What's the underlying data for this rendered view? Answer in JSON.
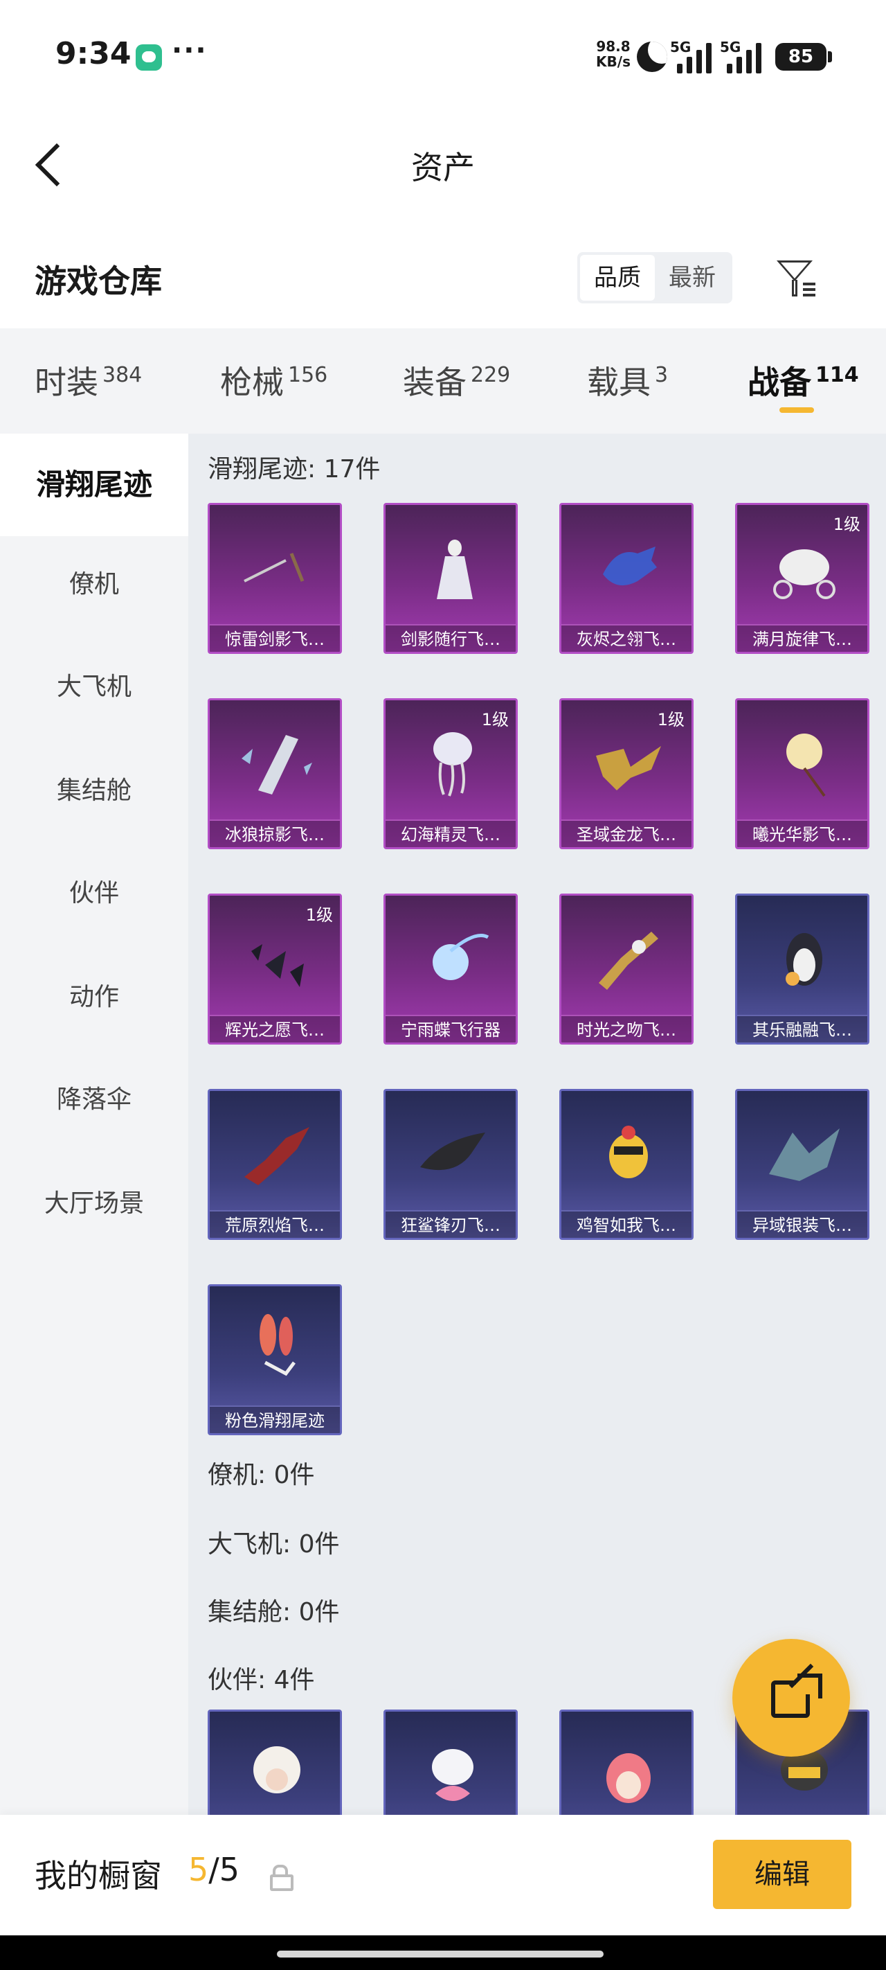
{
  "status_bar": {
    "time": "9:34",
    "dots": "···",
    "net_speed_value": "98.8",
    "net_speed_unit": "KB/s",
    "sim1": "5G",
    "sim2": "5G",
    "battery": "85"
  },
  "header": {
    "title": "资产"
  },
  "warehouse": {
    "title": "游戏仓库",
    "sort_options": [
      "品质",
      "最新"
    ],
    "sort_selected": "品质"
  },
  "category_tabs": [
    {
      "label": "时装",
      "count": "384"
    },
    {
      "label": "枪械",
      "count": "156"
    },
    {
      "label": "装备",
      "count": "229"
    },
    {
      "label": "载具",
      "count": "3"
    },
    {
      "label": "战备",
      "count": "114",
      "active": true
    }
  ],
  "sidebar": {
    "items": [
      "滑翔尾迹",
      "僚机",
      "大飞机",
      "集结舱",
      "伙伴",
      "动作",
      "降落伞",
      "大厅场景"
    ],
    "active": "滑翔尾迹"
  },
  "sections": {
    "trail_title": "滑翔尾迹: 17件",
    "wingman_title": "僚机: 0件",
    "plane_title": "大飞机: 0件",
    "capsule_title": "集结舱: 0件",
    "partner_title": "伙伴: 4件"
  },
  "trail_items": [
    {
      "name": "惊雷剑影飞…",
      "level": "",
      "rarity": "purple",
      "icon": "twin-blades-icon"
    },
    {
      "name": "剑影随行飞…",
      "level": "",
      "rarity": "purple",
      "icon": "white-figure-icon"
    },
    {
      "name": "灰烬之翎飞…",
      "level": "",
      "rarity": "purple",
      "icon": "blue-glove-icon"
    },
    {
      "name": "满月旋律飞…",
      "level": "1级",
      "rarity": "purple",
      "icon": "carriage-icon"
    },
    {
      "name": "冰狼掠影飞…",
      "level": "",
      "rarity": "purple",
      "icon": "ice-shard-icon"
    },
    {
      "name": "幻海精灵飞…",
      "level": "1级",
      "rarity": "purple",
      "icon": "jellyfish-icon"
    },
    {
      "name": "圣域金龙飞…",
      "level": "1级",
      "rarity": "purple",
      "icon": "gold-dragon-icon"
    },
    {
      "name": "曦光华影飞…",
      "level": "",
      "rarity": "purple",
      "icon": "flower-icon"
    },
    {
      "name": "辉光之愿飞…",
      "level": "1级",
      "rarity": "purple",
      "icon": "crystal-shards-icon"
    },
    {
      "name": "宁雨蝶飞行器",
      "level": "",
      "rarity": "purple",
      "icon": "energy-orb-icon"
    },
    {
      "name": "时光之吻飞…",
      "level": "",
      "rarity": "purple",
      "icon": "golden-scepter-icon"
    },
    {
      "name": "其乐融融飞…",
      "level": "",
      "rarity": "blue",
      "icon": "penguin-icon"
    },
    {
      "name": "荒原烈焰飞…",
      "level": "",
      "rarity": "blue",
      "icon": "red-wings-icon"
    },
    {
      "name": "狂鲨锋刃飞…",
      "level": "",
      "rarity": "blue",
      "icon": "shark-icon"
    },
    {
      "name": "鸡智如我飞…",
      "level": "",
      "rarity": "blue",
      "icon": "chicken-icon"
    },
    {
      "name": "异域银装飞…",
      "level": "",
      "rarity": "blue",
      "icon": "silver-wings-icon"
    },
    {
      "name": "粉色滑翔尾迹",
      "level": "",
      "rarity": "blue",
      "icon": "pink-smoke-icon"
    }
  ],
  "partner_items": [
    {
      "icon": "sheep-partner-icon",
      "rarity": "blue"
    },
    {
      "icon": "bunny-partner-icon",
      "rarity": "blue"
    },
    {
      "icon": "pink-bird-partner-icon",
      "rarity": "blue"
    },
    {
      "icon": "helmet-partner-icon",
      "rarity": "blue"
    }
  ],
  "bottom_bar": {
    "title": "我的橱窗",
    "current": "5",
    "separator": "/",
    "total": "5",
    "edit_label": "编辑"
  },
  "colors": {
    "accent": "#f5b731",
    "purple_rarity": "#a33bb2",
    "blue_rarity": "#5a5aa8",
    "content_bg": "#eaedf1"
  }
}
